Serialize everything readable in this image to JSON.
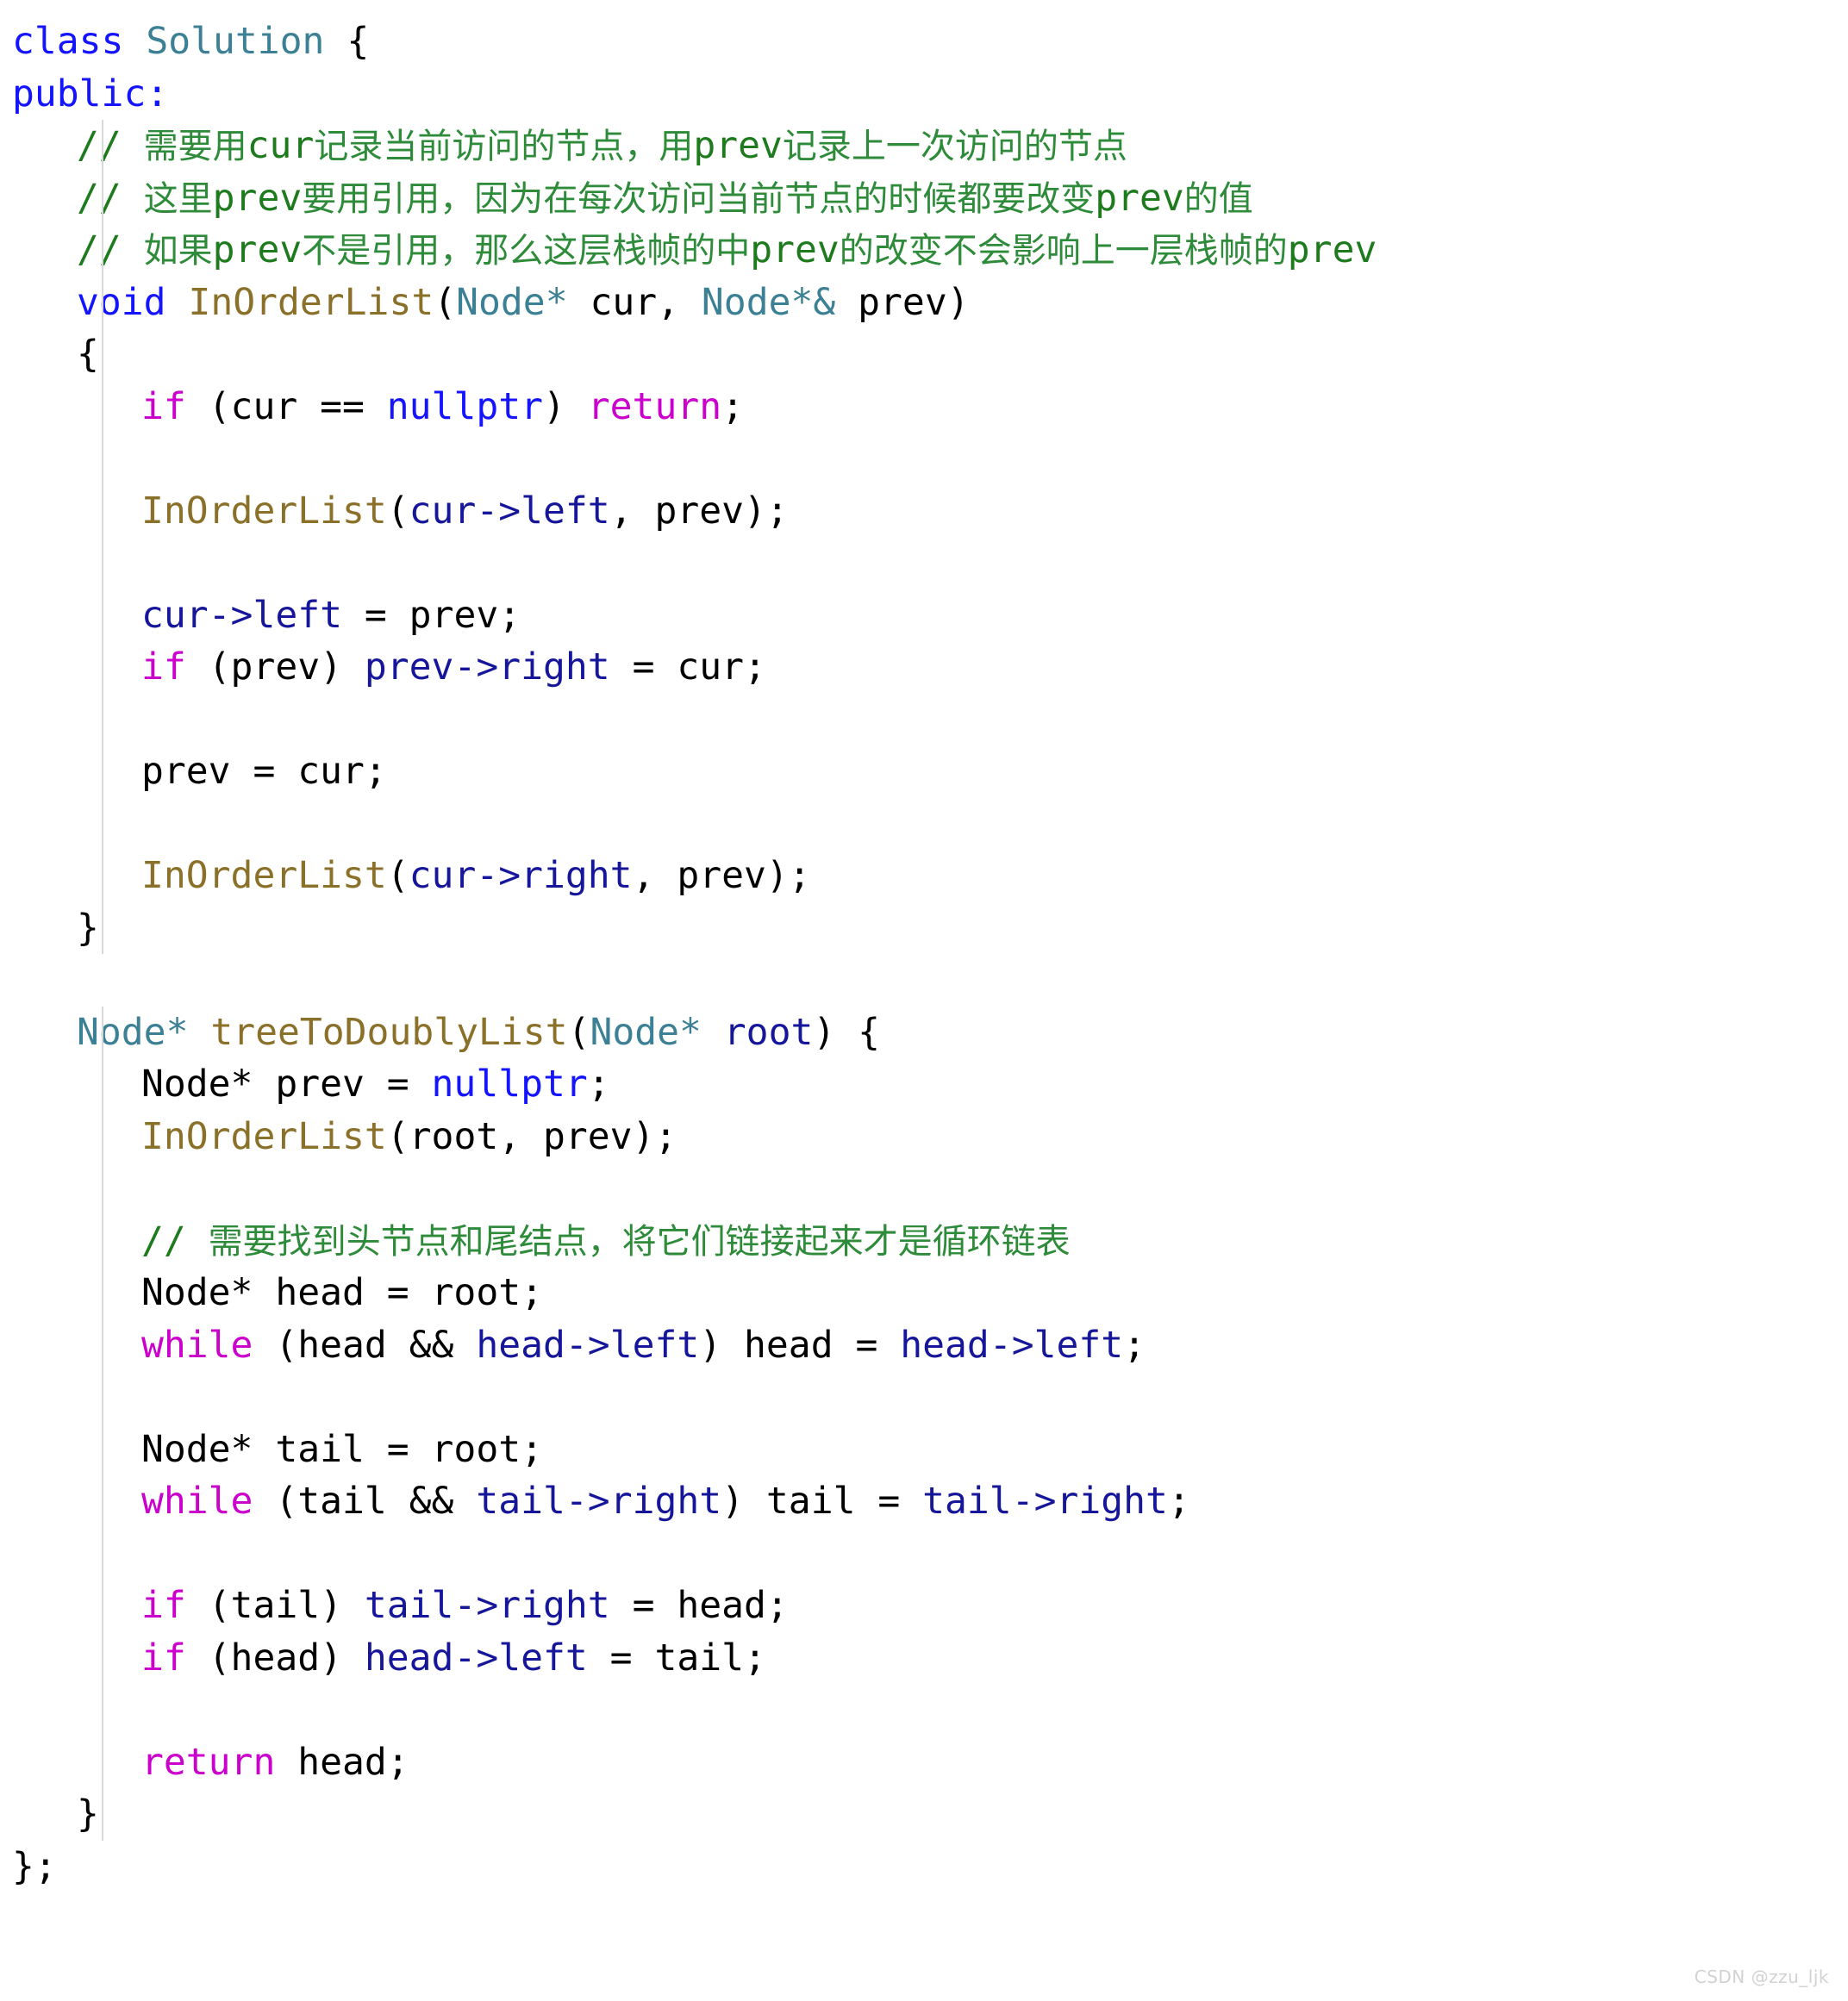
{
  "editor": {
    "language": "cpp",
    "background": "#ffffff",
    "watermark": "CSDN @zzu_ljk",
    "theme_colors": {
      "keyword": "#1414ff",
      "control": "#cc00cc",
      "type": "#3b8094",
      "function": "#8a7028",
      "member_variable": "#16169b",
      "constant": "#1414ff",
      "plain": "#000000",
      "comment": "#1d7a1d",
      "comment_cjk": "#2e8b3a",
      "indent_guide": "#d8d8d8"
    }
  },
  "code": {
    "lines": [
      {
        "id": "l01",
        "indent": 0,
        "guide": false,
        "tokens": [
          {
            "t": "class",
            "c": "kw"
          },
          {
            "t": " ",
            "c": "plain"
          },
          {
            "t": "Solution",
            "c": "classname"
          },
          {
            "t": " {",
            "c": "plain"
          }
        ]
      },
      {
        "id": "l02",
        "indent": 0,
        "guide": false,
        "tokens": [
          {
            "t": "public",
            "c": "kw"
          },
          {
            "t": ":",
            "c": "kw"
          }
        ]
      },
      {
        "id": "l03",
        "indent": 1,
        "guide": true,
        "tokens": [
          {
            "t": "// ",
            "c": "comment"
          },
          {
            "t": "需要用",
            "c": "cjk"
          },
          {
            "t": "cur",
            "c": "comment"
          },
          {
            "t": "记录当前访问的节点，用",
            "c": "cjk"
          },
          {
            "t": "prev",
            "c": "comment"
          },
          {
            "t": "记录上一次访问的节点",
            "c": "cjk"
          }
        ]
      },
      {
        "id": "l04",
        "indent": 1,
        "guide": true,
        "tokens": [
          {
            "t": "// ",
            "c": "comment"
          },
          {
            "t": "这里",
            "c": "cjk"
          },
          {
            "t": "prev",
            "c": "comment"
          },
          {
            "t": "要用引用，因为在每次访问当前节点的时候都要改变",
            "c": "cjk"
          },
          {
            "t": "prev",
            "c": "comment"
          },
          {
            "t": "的值",
            "c": "cjk"
          }
        ]
      },
      {
        "id": "l05",
        "indent": 1,
        "guide": true,
        "tokens": [
          {
            "t": "// ",
            "c": "comment"
          },
          {
            "t": "如果",
            "c": "cjk"
          },
          {
            "t": "prev",
            "c": "comment"
          },
          {
            "t": "不是引用，那么这层栈帧的中",
            "c": "cjk"
          },
          {
            "t": "prev",
            "c": "comment"
          },
          {
            "t": "的改变不会影响上一层栈帧的",
            "c": "cjk"
          },
          {
            "t": "prev",
            "c": "comment"
          }
        ]
      },
      {
        "id": "l06",
        "indent": 1,
        "guide": true,
        "tokens": [
          {
            "t": "void",
            "c": "kw"
          },
          {
            "t": " ",
            "c": "plain"
          },
          {
            "t": "InOrderList",
            "c": "fn"
          },
          {
            "t": "(",
            "c": "plain"
          },
          {
            "t": "Node",
            "c": "type"
          },
          {
            "t": "*",
            "c": "type"
          },
          {
            "t": " cur, ",
            "c": "plain"
          },
          {
            "t": "Node",
            "c": "type"
          },
          {
            "t": "*&",
            "c": "type"
          },
          {
            "t": " prev)",
            "c": "plain"
          }
        ]
      },
      {
        "id": "l07",
        "indent": 1,
        "guide": true,
        "tokens": [
          {
            "t": "{",
            "c": "plain"
          }
        ]
      },
      {
        "id": "l08",
        "indent": 2,
        "guide": true,
        "tokens": [
          {
            "t": "if",
            "c": "ctrl"
          },
          {
            "t": " (cur == ",
            "c": "plain"
          },
          {
            "t": "nullptr",
            "c": "const"
          },
          {
            "t": ") ",
            "c": "plain"
          },
          {
            "t": "return",
            "c": "ctrl"
          },
          {
            "t": ";",
            "c": "plain"
          }
        ]
      },
      {
        "id": "l09",
        "indent": 2,
        "guide": true,
        "tokens": []
      },
      {
        "id": "l10",
        "indent": 2,
        "guide": true,
        "tokens": [
          {
            "t": "InOrderList",
            "c": "fn"
          },
          {
            "t": "(",
            "c": "plain"
          },
          {
            "t": "cur",
            "c": "var"
          },
          {
            "t": "->",
            "c": "var"
          },
          {
            "t": "left",
            "c": "var"
          },
          {
            "t": ", prev);",
            "c": "plain"
          }
        ]
      },
      {
        "id": "l11",
        "indent": 2,
        "guide": true,
        "tokens": []
      },
      {
        "id": "l12",
        "indent": 2,
        "guide": true,
        "tokens": [
          {
            "t": "cur",
            "c": "var"
          },
          {
            "t": "->",
            "c": "var"
          },
          {
            "t": "left",
            "c": "var"
          },
          {
            "t": " = prev;",
            "c": "plain"
          }
        ]
      },
      {
        "id": "l13",
        "indent": 2,
        "guide": true,
        "tokens": [
          {
            "t": "if",
            "c": "ctrl"
          },
          {
            "t": " (prev) ",
            "c": "plain"
          },
          {
            "t": "prev",
            "c": "var"
          },
          {
            "t": "->",
            "c": "var"
          },
          {
            "t": "right",
            "c": "var"
          },
          {
            "t": " = cur;",
            "c": "plain"
          }
        ]
      },
      {
        "id": "l14",
        "indent": 2,
        "guide": true,
        "tokens": []
      },
      {
        "id": "l15",
        "indent": 2,
        "guide": true,
        "tokens": [
          {
            "t": "prev = cur;",
            "c": "plain"
          }
        ]
      },
      {
        "id": "l16",
        "indent": 2,
        "guide": true,
        "tokens": []
      },
      {
        "id": "l17",
        "indent": 2,
        "guide": true,
        "tokens": [
          {
            "t": "InOrderList",
            "c": "fn"
          },
          {
            "t": "(",
            "c": "plain"
          },
          {
            "t": "cur",
            "c": "var"
          },
          {
            "t": "->",
            "c": "var"
          },
          {
            "t": "right",
            "c": "var"
          },
          {
            "t": ", prev);",
            "c": "plain"
          }
        ]
      },
      {
        "id": "l18",
        "indent": 1,
        "guide": true,
        "tokens": [
          {
            "t": "}",
            "c": "plain"
          }
        ]
      },
      {
        "id": "l19",
        "indent": 0,
        "guide": false,
        "tokens": []
      },
      {
        "id": "l20",
        "indent": 1,
        "guide": true,
        "tokens": [
          {
            "t": "Node",
            "c": "type"
          },
          {
            "t": "*",
            "c": "type"
          },
          {
            "t": " ",
            "c": "plain"
          },
          {
            "t": "treeToDoublyList",
            "c": "fn"
          },
          {
            "t": "(",
            "c": "plain"
          },
          {
            "t": "Node",
            "c": "type"
          },
          {
            "t": "*",
            "c": "type"
          },
          {
            "t": " ",
            "c": "plain"
          },
          {
            "t": "root",
            "c": "var"
          },
          {
            "t": ") {",
            "c": "plain"
          }
        ]
      },
      {
        "id": "l21",
        "indent": 2,
        "guide": true,
        "tokens": [
          {
            "t": "Node* prev = ",
            "c": "plain"
          },
          {
            "t": "nullptr",
            "c": "const"
          },
          {
            "t": ";",
            "c": "plain"
          }
        ]
      },
      {
        "id": "l22",
        "indent": 2,
        "guide": true,
        "tokens": [
          {
            "t": "InOrderList",
            "c": "fn"
          },
          {
            "t": "(root, prev);",
            "c": "plain"
          }
        ]
      },
      {
        "id": "l23",
        "indent": 2,
        "guide": true,
        "tokens": []
      },
      {
        "id": "l24",
        "indent": 2,
        "guide": true,
        "tokens": [
          {
            "t": "// ",
            "c": "comment"
          },
          {
            "t": "需要找到头节点和尾结点，将它们链接起来才是循环链表",
            "c": "cjk"
          }
        ]
      },
      {
        "id": "l25",
        "indent": 2,
        "guide": true,
        "tokens": [
          {
            "t": "Node* head = root;",
            "c": "plain"
          }
        ]
      },
      {
        "id": "l26",
        "indent": 2,
        "guide": true,
        "tokens": [
          {
            "t": "while",
            "c": "ctrl"
          },
          {
            "t": " (head && ",
            "c": "plain"
          },
          {
            "t": "head",
            "c": "var"
          },
          {
            "t": "->",
            "c": "var"
          },
          {
            "t": "left",
            "c": "var"
          },
          {
            "t": ") head = ",
            "c": "plain"
          },
          {
            "t": "head",
            "c": "var"
          },
          {
            "t": "->",
            "c": "var"
          },
          {
            "t": "left",
            "c": "var"
          },
          {
            "t": ";",
            "c": "plain"
          }
        ]
      },
      {
        "id": "l27",
        "indent": 2,
        "guide": true,
        "tokens": []
      },
      {
        "id": "l28",
        "indent": 2,
        "guide": true,
        "tokens": [
          {
            "t": "Node* tail = root;",
            "c": "plain"
          }
        ]
      },
      {
        "id": "l29",
        "indent": 2,
        "guide": true,
        "tokens": [
          {
            "t": "while",
            "c": "ctrl"
          },
          {
            "t": " (tail && ",
            "c": "plain"
          },
          {
            "t": "tail",
            "c": "var"
          },
          {
            "t": "->",
            "c": "var"
          },
          {
            "t": "right",
            "c": "var"
          },
          {
            "t": ") tail = ",
            "c": "plain"
          },
          {
            "t": "tail",
            "c": "var"
          },
          {
            "t": "->",
            "c": "var"
          },
          {
            "t": "right",
            "c": "var"
          },
          {
            "t": ";",
            "c": "plain"
          }
        ]
      },
      {
        "id": "l30",
        "indent": 2,
        "guide": true,
        "tokens": []
      },
      {
        "id": "l31",
        "indent": 2,
        "guide": true,
        "tokens": [
          {
            "t": "if",
            "c": "ctrl"
          },
          {
            "t": " (tail) ",
            "c": "plain"
          },
          {
            "t": "tail",
            "c": "var"
          },
          {
            "t": "->",
            "c": "var"
          },
          {
            "t": "right",
            "c": "var"
          },
          {
            "t": " = head;",
            "c": "plain"
          }
        ]
      },
      {
        "id": "l32",
        "indent": 2,
        "guide": true,
        "tokens": [
          {
            "t": "if",
            "c": "ctrl"
          },
          {
            "t": " (head) ",
            "c": "plain"
          },
          {
            "t": "head",
            "c": "var"
          },
          {
            "t": "->",
            "c": "var"
          },
          {
            "t": "left",
            "c": "var"
          },
          {
            "t": " = tail;",
            "c": "plain"
          }
        ]
      },
      {
        "id": "l33",
        "indent": 2,
        "guide": true,
        "tokens": []
      },
      {
        "id": "l34",
        "indent": 2,
        "guide": true,
        "tokens": [
          {
            "t": "return",
            "c": "ctrl"
          },
          {
            "t": " head;",
            "c": "plain"
          }
        ]
      },
      {
        "id": "l35",
        "indent": 1,
        "guide": true,
        "tokens": [
          {
            "t": "}",
            "c": "plain"
          }
        ]
      },
      {
        "id": "l36",
        "indent": 0,
        "guide": false,
        "tokens": [
          {
            "t": "};",
            "c": "plain"
          }
        ]
      }
    ]
  }
}
